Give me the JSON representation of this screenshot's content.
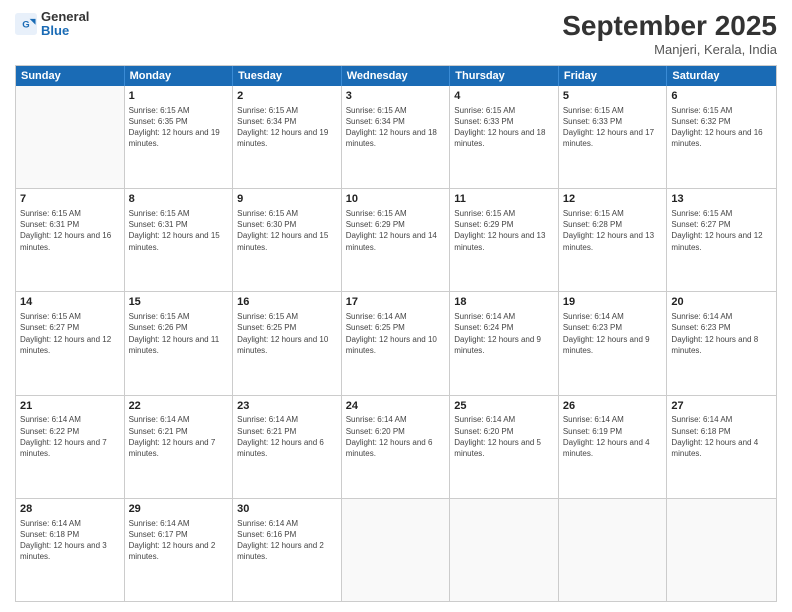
{
  "header": {
    "logo_general": "General",
    "logo_blue": "Blue",
    "month_title": "September 2025",
    "location": "Manjeri, Kerala, India"
  },
  "days_of_week": [
    "Sunday",
    "Monday",
    "Tuesday",
    "Wednesday",
    "Thursday",
    "Friday",
    "Saturday"
  ],
  "weeks": [
    [
      {
        "day": "",
        "sunrise": "",
        "sunset": "",
        "daylight": ""
      },
      {
        "day": "1",
        "sunrise": "Sunrise: 6:15 AM",
        "sunset": "Sunset: 6:35 PM",
        "daylight": "Daylight: 12 hours and 19 minutes."
      },
      {
        "day": "2",
        "sunrise": "Sunrise: 6:15 AM",
        "sunset": "Sunset: 6:34 PM",
        "daylight": "Daylight: 12 hours and 19 minutes."
      },
      {
        "day": "3",
        "sunrise": "Sunrise: 6:15 AM",
        "sunset": "Sunset: 6:34 PM",
        "daylight": "Daylight: 12 hours and 18 minutes."
      },
      {
        "day": "4",
        "sunrise": "Sunrise: 6:15 AM",
        "sunset": "Sunset: 6:33 PM",
        "daylight": "Daylight: 12 hours and 18 minutes."
      },
      {
        "day": "5",
        "sunrise": "Sunrise: 6:15 AM",
        "sunset": "Sunset: 6:33 PM",
        "daylight": "Daylight: 12 hours and 17 minutes."
      },
      {
        "day": "6",
        "sunrise": "Sunrise: 6:15 AM",
        "sunset": "Sunset: 6:32 PM",
        "daylight": "Daylight: 12 hours and 16 minutes."
      }
    ],
    [
      {
        "day": "7",
        "sunrise": "Sunrise: 6:15 AM",
        "sunset": "Sunset: 6:31 PM",
        "daylight": "Daylight: 12 hours and 16 minutes."
      },
      {
        "day": "8",
        "sunrise": "Sunrise: 6:15 AM",
        "sunset": "Sunset: 6:31 PM",
        "daylight": "Daylight: 12 hours and 15 minutes."
      },
      {
        "day": "9",
        "sunrise": "Sunrise: 6:15 AM",
        "sunset": "Sunset: 6:30 PM",
        "daylight": "Daylight: 12 hours and 15 minutes."
      },
      {
        "day": "10",
        "sunrise": "Sunrise: 6:15 AM",
        "sunset": "Sunset: 6:29 PM",
        "daylight": "Daylight: 12 hours and 14 minutes."
      },
      {
        "day": "11",
        "sunrise": "Sunrise: 6:15 AM",
        "sunset": "Sunset: 6:29 PM",
        "daylight": "Daylight: 12 hours and 13 minutes."
      },
      {
        "day": "12",
        "sunrise": "Sunrise: 6:15 AM",
        "sunset": "Sunset: 6:28 PM",
        "daylight": "Daylight: 12 hours and 13 minutes."
      },
      {
        "day": "13",
        "sunrise": "Sunrise: 6:15 AM",
        "sunset": "Sunset: 6:27 PM",
        "daylight": "Daylight: 12 hours and 12 minutes."
      }
    ],
    [
      {
        "day": "14",
        "sunrise": "Sunrise: 6:15 AM",
        "sunset": "Sunset: 6:27 PM",
        "daylight": "Daylight: 12 hours and 12 minutes."
      },
      {
        "day": "15",
        "sunrise": "Sunrise: 6:15 AM",
        "sunset": "Sunset: 6:26 PM",
        "daylight": "Daylight: 12 hours and 11 minutes."
      },
      {
        "day": "16",
        "sunrise": "Sunrise: 6:15 AM",
        "sunset": "Sunset: 6:25 PM",
        "daylight": "Daylight: 12 hours and 10 minutes."
      },
      {
        "day": "17",
        "sunrise": "Sunrise: 6:14 AM",
        "sunset": "Sunset: 6:25 PM",
        "daylight": "Daylight: 12 hours and 10 minutes."
      },
      {
        "day": "18",
        "sunrise": "Sunrise: 6:14 AM",
        "sunset": "Sunset: 6:24 PM",
        "daylight": "Daylight: 12 hours and 9 minutes."
      },
      {
        "day": "19",
        "sunrise": "Sunrise: 6:14 AM",
        "sunset": "Sunset: 6:23 PM",
        "daylight": "Daylight: 12 hours and 9 minutes."
      },
      {
        "day": "20",
        "sunrise": "Sunrise: 6:14 AM",
        "sunset": "Sunset: 6:23 PM",
        "daylight": "Daylight: 12 hours and 8 minutes."
      }
    ],
    [
      {
        "day": "21",
        "sunrise": "Sunrise: 6:14 AM",
        "sunset": "Sunset: 6:22 PM",
        "daylight": "Daylight: 12 hours and 7 minutes."
      },
      {
        "day": "22",
        "sunrise": "Sunrise: 6:14 AM",
        "sunset": "Sunset: 6:21 PM",
        "daylight": "Daylight: 12 hours and 7 minutes."
      },
      {
        "day": "23",
        "sunrise": "Sunrise: 6:14 AM",
        "sunset": "Sunset: 6:21 PM",
        "daylight": "Daylight: 12 hours and 6 minutes."
      },
      {
        "day": "24",
        "sunrise": "Sunrise: 6:14 AM",
        "sunset": "Sunset: 6:20 PM",
        "daylight": "Daylight: 12 hours and 6 minutes."
      },
      {
        "day": "25",
        "sunrise": "Sunrise: 6:14 AM",
        "sunset": "Sunset: 6:20 PM",
        "daylight": "Daylight: 12 hours and 5 minutes."
      },
      {
        "day": "26",
        "sunrise": "Sunrise: 6:14 AM",
        "sunset": "Sunset: 6:19 PM",
        "daylight": "Daylight: 12 hours and 4 minutes."
      },
      {
        "day": "27",
        "sunrise": "Sunrise: 6:14 AM",
        "sunset": "Sunset: 6:18 PM",
        "daylight": "Daylight: 12 hours and 4 minutes."
      }
    ],
    [
      {
        "day": "28",
        "sunrise": "Sunrise: 6:14 AM",
        "sunset": "Sunset: 6:18 PM",
        "daylight": "Daylight: 12 hours and 3 minutes."
      },
      {
        "day": "29",
        "sunrise": "Sunrise: 6:14 AM",
        "sunset": "Sunset: 6:17 PM",
        "daylight": "Daylight: 12 hours and 2 minutes."
      },
      {
        "day": "30",
        "sunrise": "Sunrise: 6:14 AM",
        "sunset": "Sunset: 6:16 PM",
        "daylight": "Daylight: 12 hours and 2 minutes."
      },
      {
        "day": "",
        "sunrise": "",
        "sunset": "",
        "daylight": ""
      },
      {
        "day": "",
        "sunrise": "",
        "sunset": "",
        "daylight": ""
      },
      {
        "day": "",
        "sunrise": "",
        "sunset": "",
        "daylight": ""
      },
      {
        "day": "",
        "sunrise": "",
        "sunset": "",
        "daylight": ""
      }
    ]
  ]
}
